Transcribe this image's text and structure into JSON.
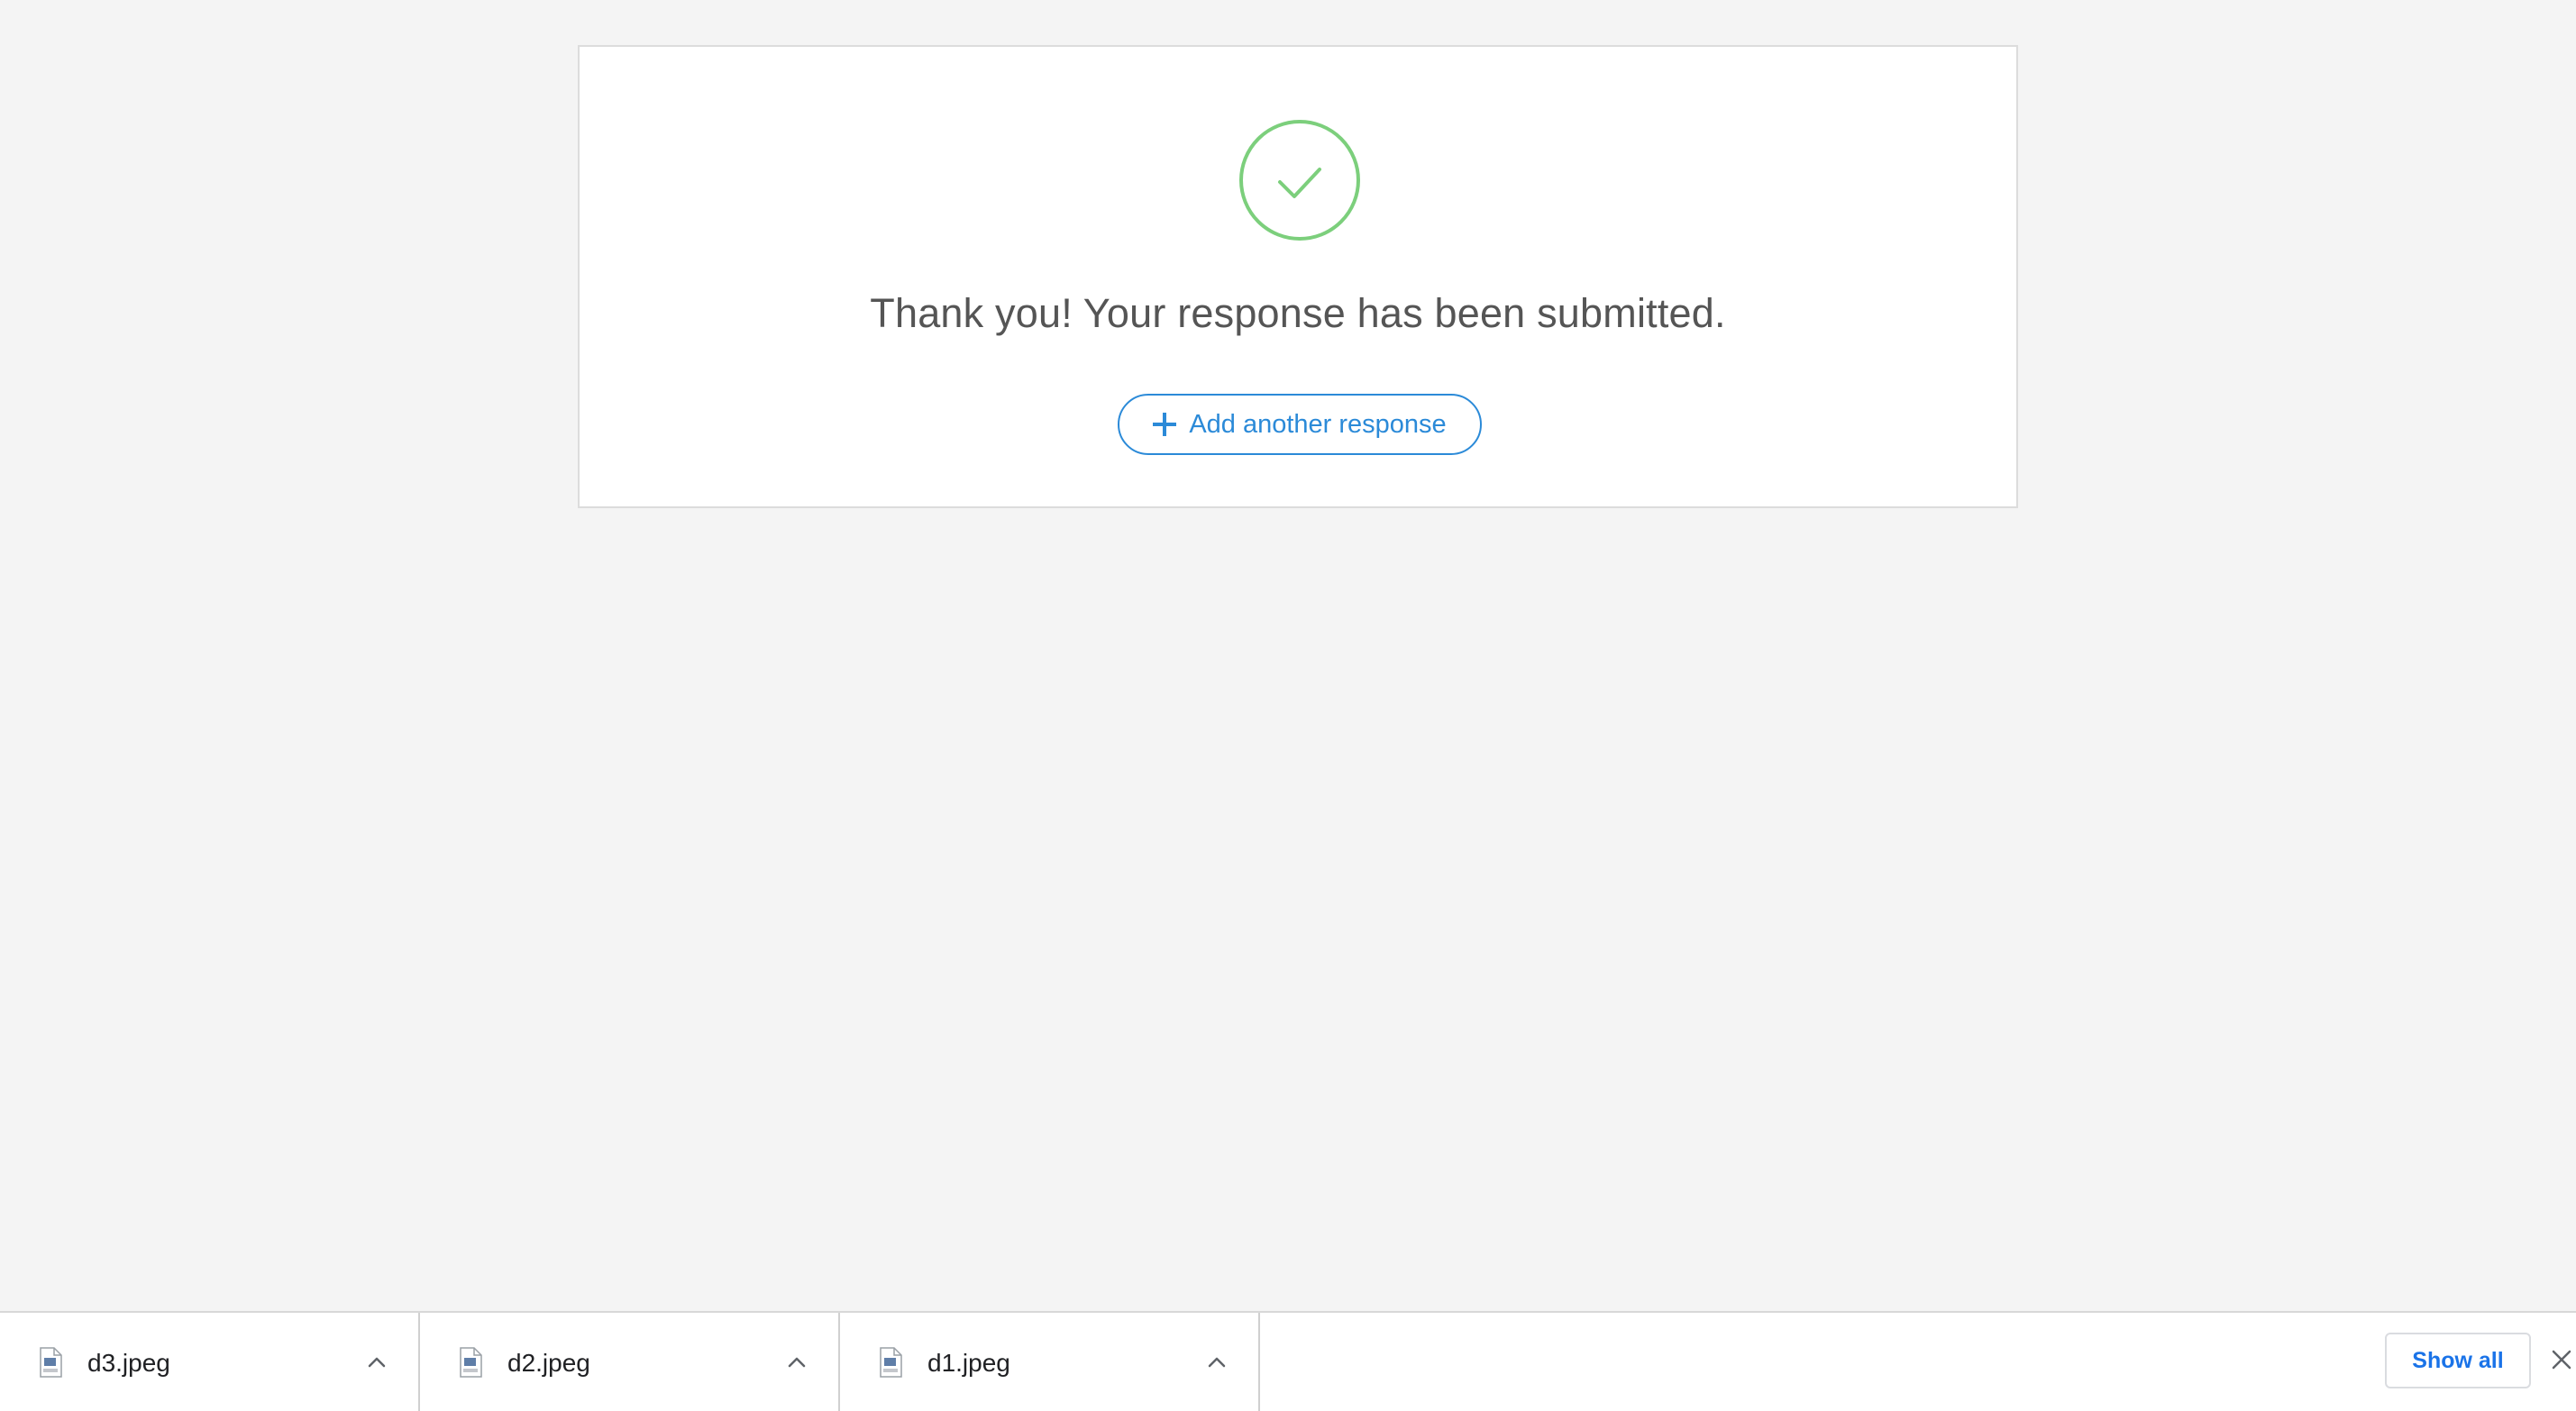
{
  "confirmation": {
    "message": "Thank you! Your response has been submitted.",
    "add_button_label": "Add another response",
    "check_color": "#7ccf7c",
    "accent_color": "#2b8ad8"
  },
  "downloads": {
    "items": [
      {
        "file_name": "d3.jpeg",
        "icon": "jpeg-file-icon"
      },
      {
        "file_name": "d2.jpeg",
        "icon": "jpeg-file-icon"
      },
      {
        "file_name": "d1.jpeg",
        "icon": "jpeg-file-icon"
      }
    ],
    "show_all_label": "Show all"
  }
}
